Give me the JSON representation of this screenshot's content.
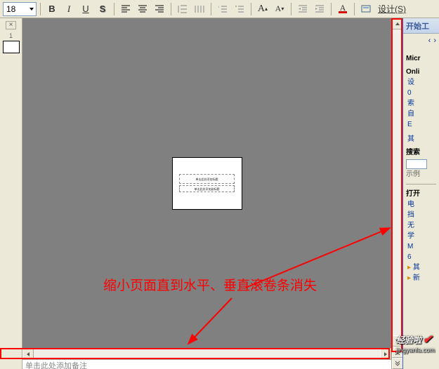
{
  "toolbar": {
    "font_size": "18",
    "bold": "B",
    "italic": "I",
    "underline": "U",
    "shadow": "S",
    "font_color_letter": "A",
    "design_label": "设计(S)"
  },
  "thumbnail": {
    "slide_num": "1"
  },
  "slide": {
    "title_placeholder": "单击此处添加标题",
    "subtitle_placeholder": "单击此处添加副标题"
  },
  "notes": {
    "placeholder": "单击此处添加备注"
  },
  "task_pane": {
    "header": "开始工",
    "section1_line1": "Micr",
    "section1_line2": "Onli",
    "links1": [
      "设",
      "0",
      "索",
      "自",
      "E"
    ],
    "links2": [
      "其"
    ],
    "search_label": "搜索",
    "example_label": "示例",
    "open_label": "打开",
    "open_links": [
      "电",
      "挡",
      "无",
      "学",
      "M",
      "6",
      "其"
    ],
    "new_label": "新"
  },
  "annotation": {
    "text": "缩小页面直到水平、垂直滚卷条消失"
  },
  "watermark": {
    "brand": "经验啦",
    "domain": "jingyanla.com"
  }
}
